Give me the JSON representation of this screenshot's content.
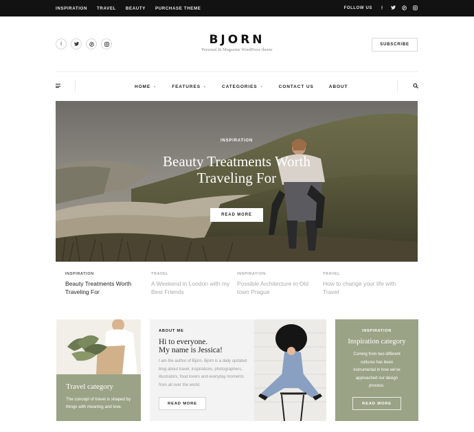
{
  "topbar": {
    "links": [
      "INSPIRATION",
      "TRAVEL",
      "BEAUTY",
      "PURCHASE THEME"
    ],
    "follow_label": "FOLLOW US",
    "follow_icons": [
      "facebook-icon",
      "twitter-icon",
      "pinterest-icon",
      "instagram-icon"
    ]
  },
  "header": {
    "social_icons": [
      "facebook-icon",
      "twitter-icon",
      "pinterest-icon",
      "instagram-icon"
    ],
    "logo": "BJORN",
    "tagline": "Personal & Magazine WordPress theme",
    "subscribe_label": "SUBSCRIBE"
  },
  "nav": {
    "items": [
      {
        "label": "HOME",
        "has_dropdown": true
      },
      {
        "label": "FEATURES",
        "has_dropdown": true
      },
      {
        "label": "CATEGORIES",
        "has_dropdown": true
      },
      {
        "label": "CONTACT US",
        "has_dropdown": false
      },
      {
        "label": "ABOUT",
        "has_dropdown": false
      }
    ]
  },
  "hero": {
    "category": "INSPIRATION",
    "title_line1": "Beauty Treatments Worth",
    "title_line2": "Traveling For",
    "button_label": "READ MORE"
  },
  "posts": [
    {
      "category": "INSPIRATION",
      "title": "Beauty Treatments Worth Traveling For",
      "active": true
    },
    {
      "category": "TRAVEL",
      "title": "A Weekend in London with my Best Friends",
      "active": false
    },
    {
      "category": "INSPIRATION",
      "title": "Possible Architecture in Old town Prague",
      "active": false
    },
    {
      "category": "TRAVEL",
      "title": "How to change your life with Travel",
      "active": false
    }
  ],
  "travel_card": {
    "title": "Travel category",
    "description": "The concept of travel is shaped by things with meaning and love."
  },
  "about_card": {
    "label": "ABOUT ME",
    "heading_line1": "Hi to everyone.",
    "heading_line2": "My name is Jessica!",
    "text": "I am the author of Bjorn. Bjorn is a daily updated blog about travel, inspirations, photographers, illustrators, food lovers and everyday moments from all over the world.",
    "button_label": "READ MORE"
  },
  "inspiration_card": {
    "label": "INSPIRATION",
    "title": "Inspiration category",
    "description": "Coming from two different cultures has been instrumental in how we've approached our design process.",
    "button_label": "READ MORE"
  },
  "colors": {
    "topbar_bg": "#121212",
    "sage_accent": "#9aa386",
    "text_dark": "#222222",
    "text_muted": "#aaaaaa"
  }
}
